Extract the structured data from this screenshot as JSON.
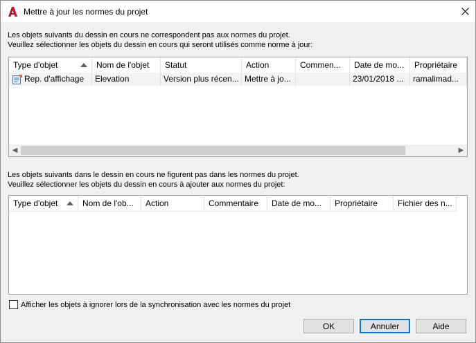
{
  "window": {
    "title": "Mettre à jour les normes du projet"
  },
  "top_section": {
    "desc_line1": "Les objets suivants du dessin en cours ne correspondent pas aux normes du projet.",
    "desc_line2": "Veuillez sélectionner les objets du dessin en cours qui seront utilisés comme norme à jour:",
    "columns": [
      "Type d'objet",
      "Nom de l'objet",
      "Statut",
      "Action",
      "Commen...",
      "Date de mo...",
      "Propriétaire"
    ],
    "rows": [
      {
        "type": "Rep. d'affichage",
        "name": "Elevation",
        "status": "Version plus récen...",
        "action": "Mettre à jo...",
        "comment": "",
        "date": "23/01/2018 ...",
        "owner": "ramalimad..."
      }
    ]
  },
  "bottom_section": {
    "desc_line1": "Les objets suivants dans le dessin en cours ne figurent pas dans les normes du projet.",
    "desc_line2": "Veuillez sélectionner les objets du dessin en cours à ajouter aux normes du projet:",
    "columns": [
      "Type d'objet",
      "Nom de l'ob...",
      "Action",
      "Commentaire",
      "Date de mo...",
      "Propriétaire",
      "Fichier des n..."
    ]
  },
  "checkbox": {
    "label": "Afficher les objets à ignorer lors de la synchronisation avec les normes du projet",
    "checked": false
  },
  "buttons": {
    "ok": "OK",
    "cancel": "Annuler",
    "help": "Aide"
  },
  "colors": {
    "app_icon_red": "#c8102e",
    "default_button_border": "#0078d7"
  }
}
